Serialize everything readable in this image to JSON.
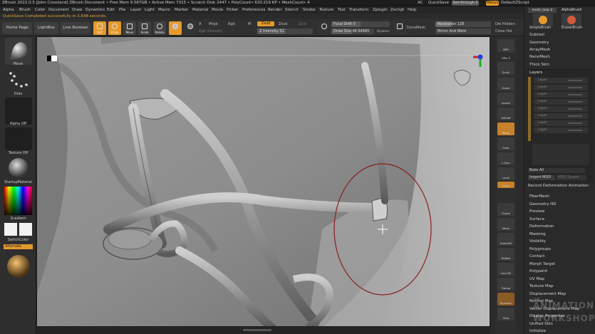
{
  "titlebar": {
    "title": "ZBrush 2022.0.5 [John Crossland]   ZBrush Document   • Free Mem 9.587GB • Active Mem 7315 • Scratch Disk 2447 • PolyCount• 620.219 KP • MeshCount• 4",
    "ac": "AC",
    "quicksave": "QuickSave",
    "seethrough": "See-through  0",
    "menus_btn": "Menus",
    "script": "DefaultZScript"
  },
  "menubar": [
    "Alpha",
    "Brush",
    "Color",
    "Document",
    "Draw",
    "Dynamics",
    "Edit",
    "File",
    "Layer",
    "Light",
    "Macro",
    "Marker",
    "Material",
    "Movie",
    "Picker",
    "Preferences",
    "Render",
    "Stencil",
    "Stroke",
    "Texture",
    "Tool",
    "Transform",
    "Zplugin",
    "Zscript",
    "Help"
  ],
  "notice": "QuickSave Completed successfully in 3.648 seconds.",
  "toolbar": {
    "home": "Home Page",
    "lightbox": "LightBox",
    "live_boolean": "Live Boolean",
    "edit": "Edit",
    "draw": "Draw",
    "move": "Move",
    "scale": "Scale",
    "rotate": "Rotate",
    "a": "A",
    "mrgb": "Mrgb",
    "rgb": "Rgb",
    "m": "M",
    "zadd": "Zadd",
    "zsub": "Zsub",
    "zcut": "Zcut",
    "rgb_intensity": "Rgb Intensity",
    "z_intensity": "Z Intensity 51",
    "focal_shift": "Focal Shift 0",
    "draw_size": "Draw Size 48.64685",
    "dynamic": "Dynamic",
    "dynamesh": "DynaMesh",
    "resolution": "Resolution 128",
    "mirror_weld": "Mirror And Weld",
    "del_hidden": "Del Hidden",
    "close_holes": "Close Hol"
  },
  "left_shelf": {
    "move": "Move",
    "dots": "Dots",
    "alpha_off": "Alpha Off",
    "texture_off": "Texture Off",
    "startup_material": "StartupMaterial",
    "gradient": "Gradient",
    "switch_color": "SwitchColor",
    "alternate": "Alternate"
  },
  "right_shelf": [
    "BPR",
    "SPix 3",
    "Scroll",
    "Zoom",
    "Actual",
    "AAHalf",
    "Persp",
    "Floor",
    "L.Sym",
    "Local",
    "Gxyz",
    "Frame",
    "Move",
    "Zoom3D",
    "Rotate",
    "Line Fill",
    "Transp",
    "Dynamic",
    "Solo"
  ],
  "tray": {
    "mesh_label": "mesh_loop-2",
    "alpha_brush": "AlphaBrush",
    "simple_brush": "SimpleBrush",
    "eraser_brush": "EraserBrush",
    "top_items": [
      "Subtool",
      "Geometry",
      "ArrayMesh",
      "NanoMesh",
      "Thick Skin"
    ],
    "layers_header": "Layers",
    "layers": [
      "Layer",
      "Layer",
      "Layer",
      "Layer",
      "Layer",
      "Layer",
      "Layer",
      "Layer"
    ],
    "bake_all": "Bake All",
    "import_mdd": "Import MDD",
    "mdd_speed": "MDD Speed",
    "record_anim": "Record Deformation Animation",
    "bottom_items": [
      "FiberMesh",
      "Geometry HD",
      "Preview",
      "Surface",
      "Deformation",
      "Masking",
      "Visibility",
      "Polygroups",
      "Contact",
      "Morph Target",
      "Polypaint",
      "UV Map",
      "Texture Map",
      "Displacement Map",
      "Normal Map",
      "Vector Displacement Map",
      "Display Properties",
      "Unified Skin",
      "Initialize"
    ]
  },
  "watermark": {
    "line1": "ANIMATION",
    "line2": "WORKSHOP",
    "small": "THE"
  },
  "colors": {
    "accent": "#e59a2c",
    "viewport_bg": "#8f8f8f",
    "panel": "#2b2b2b"
  }
}
